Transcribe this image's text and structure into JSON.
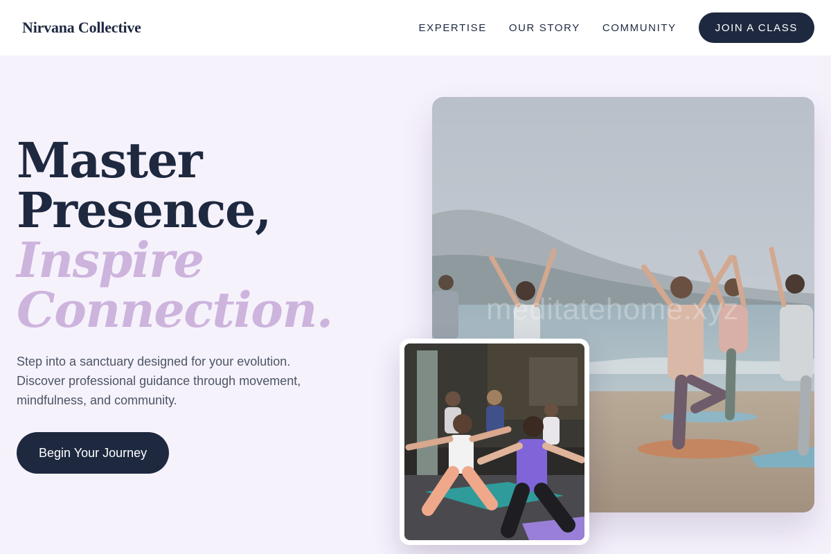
{
  "header": {
    "logo": "Nirvana Collective",
    "nav": [
      {
        "label": "EXPERTISE"
      },
      {
        "label": "OUR STORY"
      },
      {
        "label": "COMMUNITY"
      }
    ],
    "cta_label": "JOIN A CLASS"
  },
  "hero": {
    "title_line1": "Master",
    "title_line2": "Presence,",
    "accent_line1": "Inspire",
    "accent_line2": "Connection.",
    "description": "Step into a sanctuary designed for your evolution. Discover professional guidance through movement, mindfulness, and community.",
    "button_label": "Begin Your Journey"
  },
  "images": {
    "main_alt": "Group yoga class on a beach with arms raised",
    "main_watermark": "meditatehome.xyz",
    "secondary_alt": "Indoor yoga class in warrior pose"
  },
  "colors": {
    "navy": "#1e2940",
    "accent": "#cdb4dd",
    "background": "#f6f2fc"
  }
}
